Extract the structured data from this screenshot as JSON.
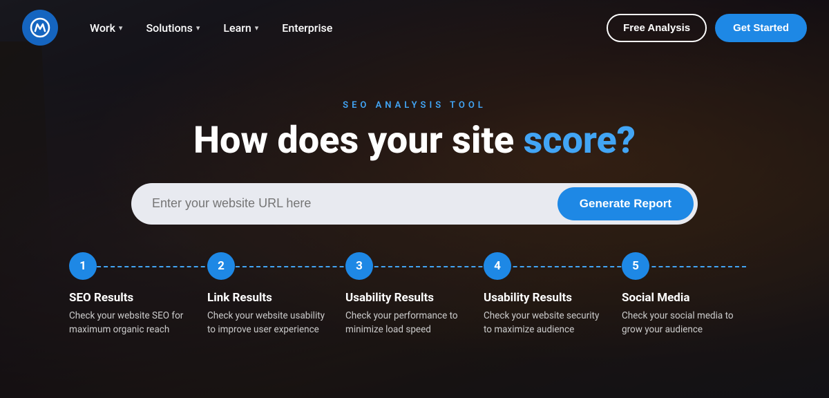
{
  "brand": {
    "logo_alt": "Moz logo"
  },
  "nav": {
    "items": [
      {
        "label": "Work",
        "has_chevron": true
      },
      {
        "label": "Solutions",
        "has_chevron": true
      },
      {
        "label": "Learn",
        "has_chevron": true
      },
      {
        "label": "Enterprise",
        "has_chevron": false
      }
    ],
    "btn_outline": "Free Analysis",
    "btn_primary": "Get Started"
  },
  "hero": {
    "subtitle": "SEO ANALYSIS TOOL",
    "headline_part1": "How does your site ",
    "headline_part2": "score?",
    "input_placeholder": "Enter your website URL here",
    "btn_generate": "Generate Report"
  },
  "steps": [
    {
      "number": "1",
      "title": "SEO Results",
      "desc": "Check your website SEO for maximum organic reach"
    },
    {
      "number": "2",
      "title": "Link Results",
      "desc": "Check your website usability to improve user experience"
    },
    {
      "number": "3",
      "title": "Usability Results",
      "desc": "Check your performance to minimize load speed"
    },
    {
      "number": "4",
      "title": "Usability Results",
      "desc": "Check your website security to maximize audience"
    },
    {
      "number": "5",
      "title": "Social Media",
      "desc": "Check your social media to grow your audience"
    }
  ]
}
